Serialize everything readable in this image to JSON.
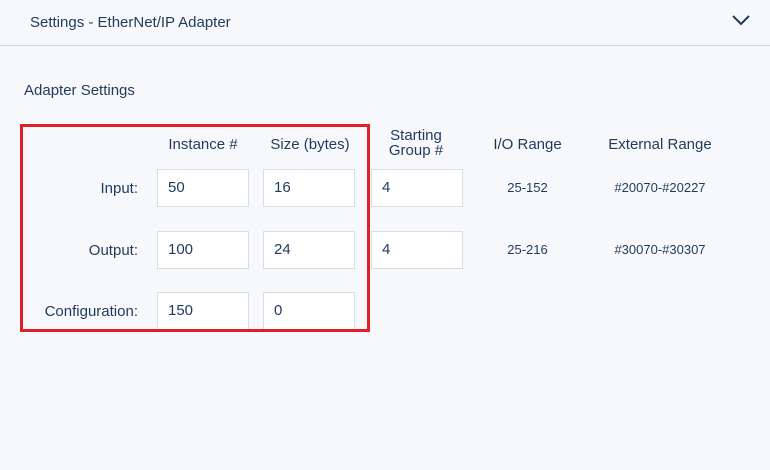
{
  "header": {
    "title": "Settings - EtherNet/IP Adapter",
    "collapse_icon": "chevron-down-icon"
  },
  "section": {
    "title": "Adapter Settings"
  },
  "columns": {
    "instance": "Instance #",
    "size": "Size (bytes)",
    "starting_group_line1": "Starting",
    "starting_group_line2": "Group #",
    "io_range": "I/O Range",
    "external_range": "External Range"
  },
  "rows": [
    {
      "label": "Input:",
      "instance": "50",
      "size": "16",
      "starting_group": "4",
      "io_range": "25-152",
      "external_range": "#20070-#20227"
    },
    {
      "label": "Output:",
      "instance": "100",
      "size": "24",
      "starting_group": "4",
      "io_range": "25-216",
      "external_range": "#30070-#30307"
    },
    {
      "label": "Configuration:",
      "instance": "150",
      "size": "0"
    }
  ],
  "colors": {
    "text": "#1f3a5c",
    "background": "#f6f8fb",
    "highlight": "#e01f26",
    "field_border": "#d7dde4"
  }
}
